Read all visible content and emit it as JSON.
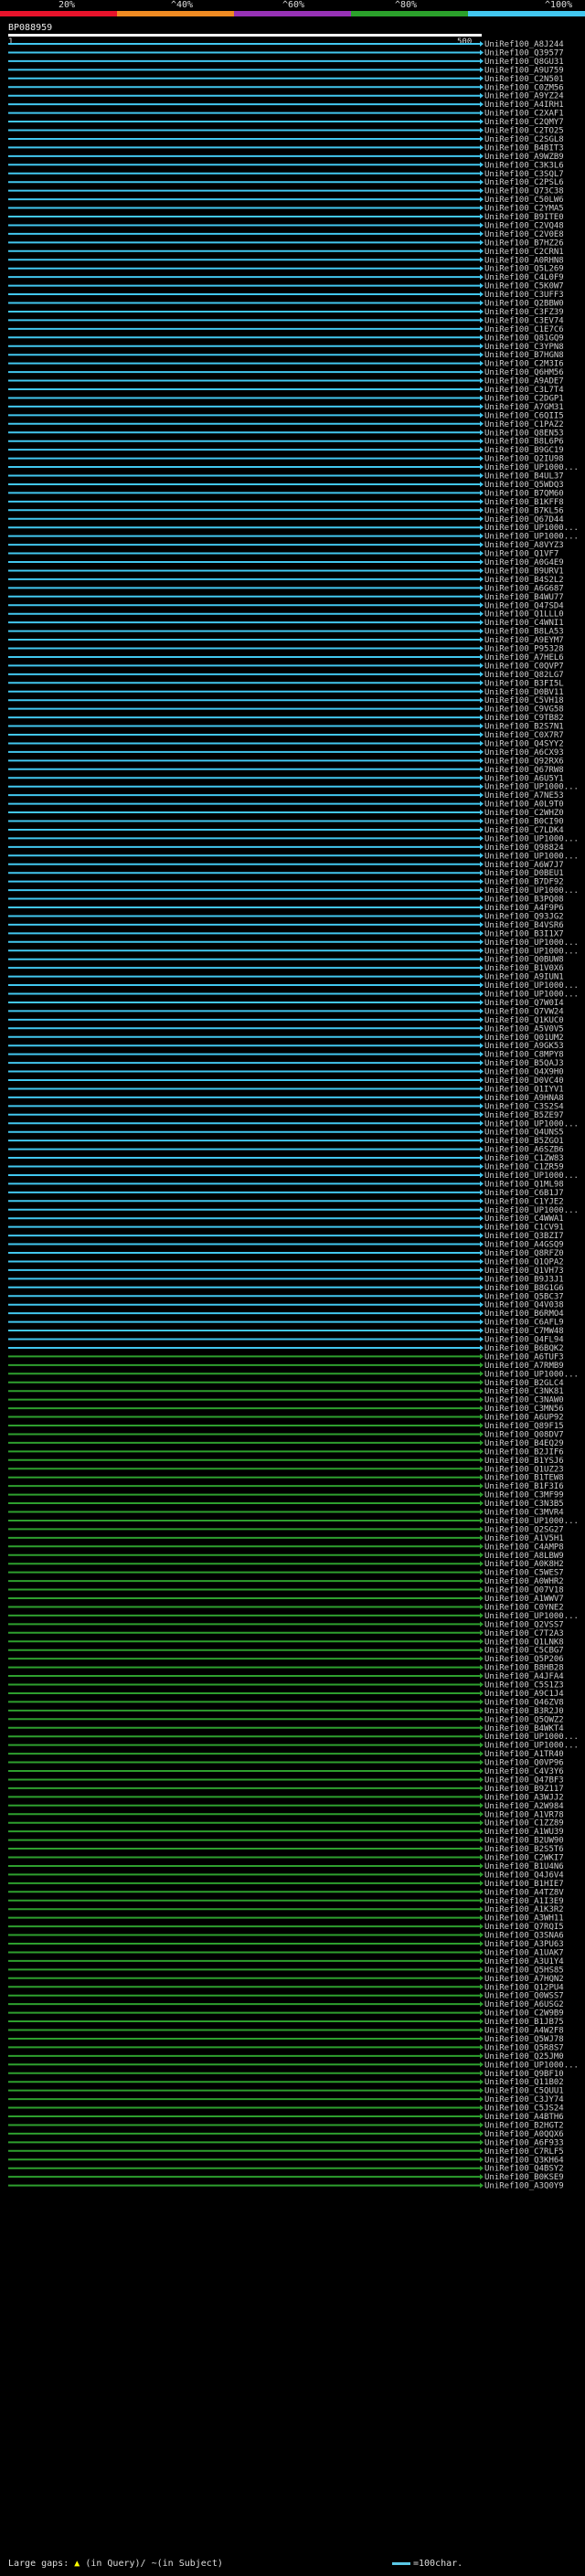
{
  "legend": {
    "labels": [
      "20%",
      "^40%",
      "^60%",
      "^80%",
      "^100%"
    ],
    "colors": [
      "#e8132b",
      "#f08b22",
      "#9732b6",
      "#2ba12b",
      "#42c7ef"
    ]
  },
  "query": {
    "id": "BP088959",
    "start": "1",
    "end": "500"
  },
  "hit_colors": {
    "blue": "#42c7ef",
    "green": "#2e9f2e"
  },
  "hits": [
    "UniRef100_A8J244",
    "UniRef100_Q39577",
    "UniRef100_Q8GU31",
    "UniRef100_A9U759",
    "UniRef100_C2N501",
    "UniRef100_C0ZM56",
    "UniRef100_A9YZ24",
    "UniRef100_A4IRH1",
    "UniRef100_C2XAF1",
    "UniRef100_C2QMY7",
    "UniRef100_C2TO25",
    "UniRef100_C2SGL8",
    "UniRef100_B4BIT3",
    "UniRef100_A9WZB9",
    "UniRef100_C3K3L6",
    "UniRef100_C3SQL7",
    "UniRef100_C2PSL6",
    "UniRef100_Q73C38",
    "UniRef100_C50LW6",
    "UniRef100_C2YMA5",
    "UniRef100_B9ITE0",
    "UniRef100_C2VQ48",
    "UniRef100_C2V0E8",
    "UniRef100_B7HZ26",
    "UniRef100_C2CRN1",
    "UniRef100_A0RHN8",
    "UniRef100_Q5L269",
    "UniRef100_C4L0F9",
    "UniRef100_C5K0W7",
    "UniRef100_C3UFF3",
    "UniRef100_Q2BBW0",
    "UniRef100_C3FZ39",
    "UniRef100_C3EV74",
    "UniRef100_C1E7C6",
    "UniRef100_Q81GQ9",
    "UniRef100_C3YPN8",
    "UniRef100_B7HGN8",
    "UniRef100_C2M3I6",
    "UniRef100_Q6HM56",
    "UniRef100_A9ADE7",
    "UniRef100_C3L7T4",
    "UniRef100_C2DGP1",
    "UniRef100_A7GM31",
    "UniRef100_C6QII5",
    "UniRef100_C1PAZ2",
    "UniRef100_Q8EN53",
    "UniRef100_B8L6P6",
    "UniRef100_B9GC19",
    "UniRef100_Q2IU98",
    "UniRef100_UP1000...",
    "UniRef100_B4UL37",
    "UniRef100_Q5WDQ3",
    "UniRef100_B7QM60",
    "UniRef100_B1KFF8",
    "UniRef100_B7KL56",
    "UniRef100_Q67D44",
    "UniRef100_UP1000...",
    "UniRef100_UP1000...",
    "UniRef100_A8VYZ3",
    "UniRef100_Q1VF7",
    "UniRef100_A0G4E9",
    "UniRef100_B9URV1",
    "UniRef100_B4S2L2",
    "UniRef100_A6G687",
    "UniRef100_B4WU77",
    "UniRef100_Q47SD4",
    "UniRef100_Q1LLL0",
    "UniRef100_C4WNI1",
    "UniRef100_B8LA53",
    "UniRef100_A9EYM7",
    "UniRef100_P95328",
    "UniRef100_A7HEL6",
    "UniRef100_C0QVP7",
    "UniRef100_Q82LG7",
    "UniRef100_B3FI5L",
    "UniRef100_D0BV11",
    "UniRef100_C5VH18",
    "UniRef100_C9VG58",
    "UniRef100_C9TB82",
    "UniRef100_B2S7N1",
    "UniRef100_C0X7R7",
    "UniRef100_Q4SYY2",
    "UniRef100_A6CX93",
    "UniRef100_Q92RX6",
    "UniRef100_Q67RW8",
    "UniRef100_A6U5Y1",
    "UniRef100_UP1000...",
    "UniRef100_A7NE53",
    "UniRef100_A0L9T0",
    "UniRef100_C2WHZ0",
    "UniRef100_B0CI90",
    "UniRef100_C7LDK4",
    "UniRef100_UP1000...",
    "UniRef100_Q98824",
    "UniRef100_UP1000...",
    "UniRef100_A6W7J7",
    "UniRef100_D0BEU1",
    "UniRef100_B7DF92",
    "UniRef100_UP1000...",
    "UniRef100_B3PQ08",
    "UniRef100_A4F9P6",
    "UniRef100_Q93JG2",
    "UniRef100_B4VSR6",
    "UniRef100_B3I1X7",
    "UniRef100_UP1000...",
    "UniRef100_UP1000...",
    "UniRef100_Q0BUW8",
    "UniRef100_B1V0X6",
    "UniRef100_A9IUN1",
    "UniRef100_UP1000...",
    "UniRef100_UP1000...",
    "UniRef100_Q7W0I4",
    "UniRef100_Q7VW24",
    "UniRef100_Q1KUC0",
    "UniRef100_A5V0V5",
    "UniRef100_Q01UM2",
    "UniRef100_A9GK53",
    "UniRef100_C8MPY8",
    "UniRef100_B5QAJ3",
    "UniRef100_Q4X9H0",
    "UniRef100_D0VC40",
    "UniRef100_Q1IYV1",
    "UniRef100_A9HNA8",
    "UniRef100_C3S2S4",
    "UniRef100_B5ZE97",
    "UniRef100_UP1000...",
    "UniRef100_Q4UNS5",
    "UniRef100_B5ZGO1",
    "UniRef100_A6SZB6",
    "UniRef100_C1ZW83",
    "UniRef100_C1ZR59",
    "UniRef100_UP1000...",
    "UniRef100_Q1ML98",
    "UniRef100_C6B1J7",
    "UniRef100_C1YJE2",
    "UniRef100_UP1000...",
    "UniRef100_C4WWA1",
    "UniRef100_C1CV91",
    "UniRef100_Q3BZI7",
    "UniRef100_A4GSQ9",
    "UniRef100_Q8RFZ0",
    "UniRef100_Q1QPA2",
    "UniRef100_Q1VH73",
    "UniRef100_B9J3J1",
    "UniRef100_B8G1G6",
    "UniRef100_Q5BC37",
    "UniRef100_Q4V038",
    "UniRef100_B6RMO4",
    "UniRef100_C6AFL9",
    "UniRef100_C7MW48",
    "UniRef100_Q4FL94",
    "UniRef100_B6BQK2",
    "UniRef100_A6TUF3",
    "UniRef100_A7RMB9",
    "UniRef100_UP1000...",
    "UniRef100_B2GLC4",
    "UniRef100_C3NK81",
    "UniRef100_C3NAW0",
    "UniRef100_C3MN56",
    "UniRef100_A6UP92",
    "UniRef100_Q89F15",
    "UniRef100_Q08DV7",
    "UniRef100_B4EQ29",
    "UniRef100_B2JIF6",
    "UniRef100_B1YSJ6",
    "UniRef100_Q1UZ23",
    "UniRef100_B1TEW8",
    "UniRef100_B1F3I6",
    "UniRef100_C3MF99",
    "UniRef100_C3N3B5",
    "UniRef100_C3MVR4",
    "UniRef100_UP1000...",
    "UniRef100_Q2SG27",
    "UniRef100_A1V5H1",
    "UniRef100_C4AMP8",
    "UniRef100_A8LBW9",
    "UniRef100_A0K8H2",
    "UniRef100_C5WES7",
    "UniRef100_A0WHR2",
    "UniRef100_Q07V18",
    "UniRef100_A1WWV7",
    "UniRef100_C0YNE2",
    "UniRef100_UP1000...",
    "UniRef100_Q2VSS7",
    "UniRef100_C7T2A3",
    "UniRef100_Q1LNK8",
    "UniRef100_C5CBG7",
    "UniRef100_Q5P206",
    "UniRef100_B8HB28",
    "UniRef100_A4JFA4",
    "UniRef100_C5S1Z3",
    "UniRef100_A9C1J4",
    "UniRef100_Q46ZV8",
    "UniRef100_B3R2J0",
    "UniRef100_Q5QWZ2",
    "UniRef100_B4WKT4",
    "UniRef100_UP1000...",
    "UniRef100_UP1000...",
    "UniRef100_A1TR40",
    "UniRef100_Q0VP96",
    "UniRef100_C4V3Y6",
    "UniRef100_Q47BF3",
    "UniRef100_B9Z117",
    "UniRef100_A3WJJ2",
    "UniRef100_A2W984",
    "UniRef100_A1VR78",
    "UniRef100_C1ZZ89",
    "UniRef100_A1WU39",
    "UniRef100_B2UW90",
    "UniRef100_B2S5T6",
    "UniRef100_C2WKI7",
    "UniRef100_B1U4N6",
    "UniRef100_Q4J6V4",
    "UniRef100_B1HIE7",
    "UniRef100_A4TZ8V",
    "UniRef100_A1I3E9",
    "UniRef100_A1K3R2",
    "UniRef100_A3WH11",
    "UniRef100_Q7RQI5",
    "UniRef100_Q3SNA6",
    "UniRef100_A3PU63",
    "UniRef100_A1UAK7",
    "UniRef100_A3U1Y4",
    "UniRef100_Q5HS85",
    "UniRef100_A7HQN2",
    "UniRef100_Q12PU4",
    "UniRef100_Q0WSS7",
    "UniRef100_A6USG2",
    "UniRef100_C2W9B9",
    "UniRef100_B1JB75",
    "UniRef100_A4W2F8",
    "UniRef100_Q5WJ78",
    "UniRef100_Q5R8S7",
    "UniRef100_Q25JM0",
    "UniRef100_UP1000...",
    "UniRef100_Q9BF10",
    "UniRef100_Q11B02",
    "UniRef100_C5QUU1",
    "UniRef100_C3JY74",
    "UniRef100_C5JS24",
    "UniRef100_A4BTH6",
    "UniRef100_B2HGT2",
    "UniRef100_A0QQX6",
    "UniRef100_A6F933",
    "UniRef100_C7RLF5",
    "UniRef100_Q3KH64",
    "UniRef100_Q4BSY2",
    "UniRef100_B0KSE9",
    "UniRef100_A3Q0Y9"
  ],
  "footer": {
    "large_gaps_label": "Large gaps:",
    "query_gap": "(in Query)/",
    "subject_gap": "~(in Subject)",
    "scale_label": "=100char."
  }
}
